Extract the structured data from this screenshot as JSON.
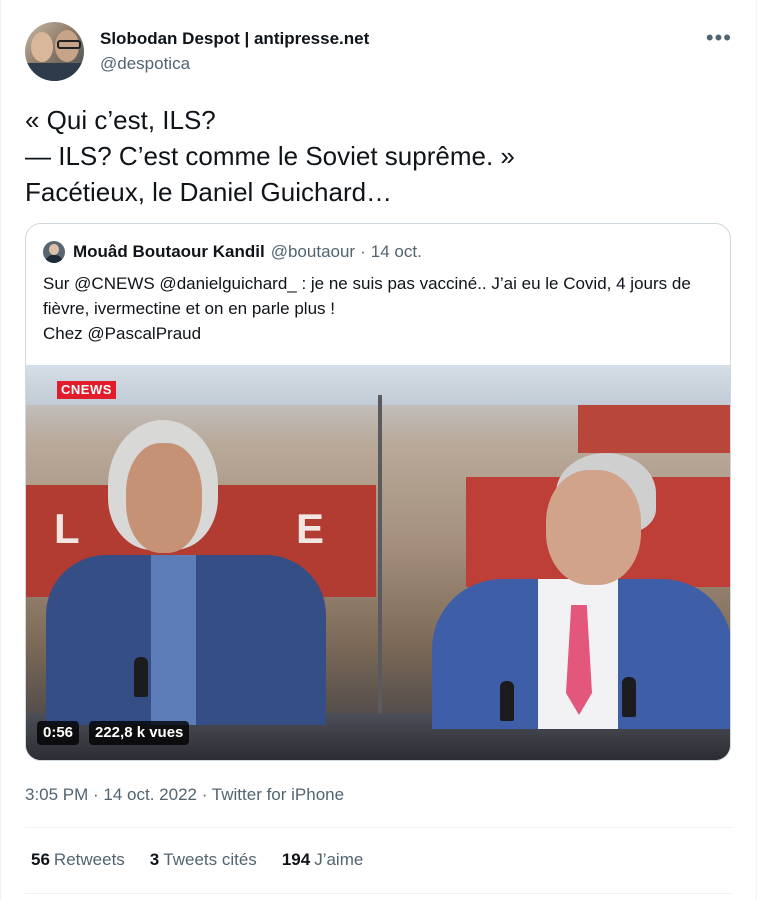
{
  "author": {
    "display_name": "Slobodan Despot | antipresse.net",
    "handle": "@despotica"
  },
  "tweet": {
    "text": "« Qui c’est, ILS?\n— ILS? C’est comme le Soviet suprême. »\nFacétieux, le Daniel Guichard…"
  },
  "quoted_tweet": {
    "display_name": "Mouâd Boutaour Kandil",
    "handle": "@boutaour",
    "separator": "·",
    "date": "14 oct.",
    "text": "Sur @CNEWS @danielguichard_ : je ne suis pas vacciné.. J’ai eu le Covid, 4 jours de fièvre, ivermectine et on en parle plus !\nChez @PascalPraud",
    "video": {
      "channel_logo": "CNEWS",
      "duration": "0:56",
      "views": "222,8 k vues"
    }
  },
  "meta": {
    "timestamp": "3:05 PM · 14 oct. 2022 · Twitter for iPhone"
  },
  "stats": [
    {
      "count": "56",
      "label": "Retweets"
    },
    {
      "count": "3",
      "label": "Tweets cités"
    },
    {
      "count": "194",
      "label": "J’aime"
    }
  ],
  "icons": {
    "more": "more-horizontal-icon"
  },
  "colors": {
    "text": "#0f1419",
    "secondary": "#536471",
    "border": "#cfd9de"
  }
}
